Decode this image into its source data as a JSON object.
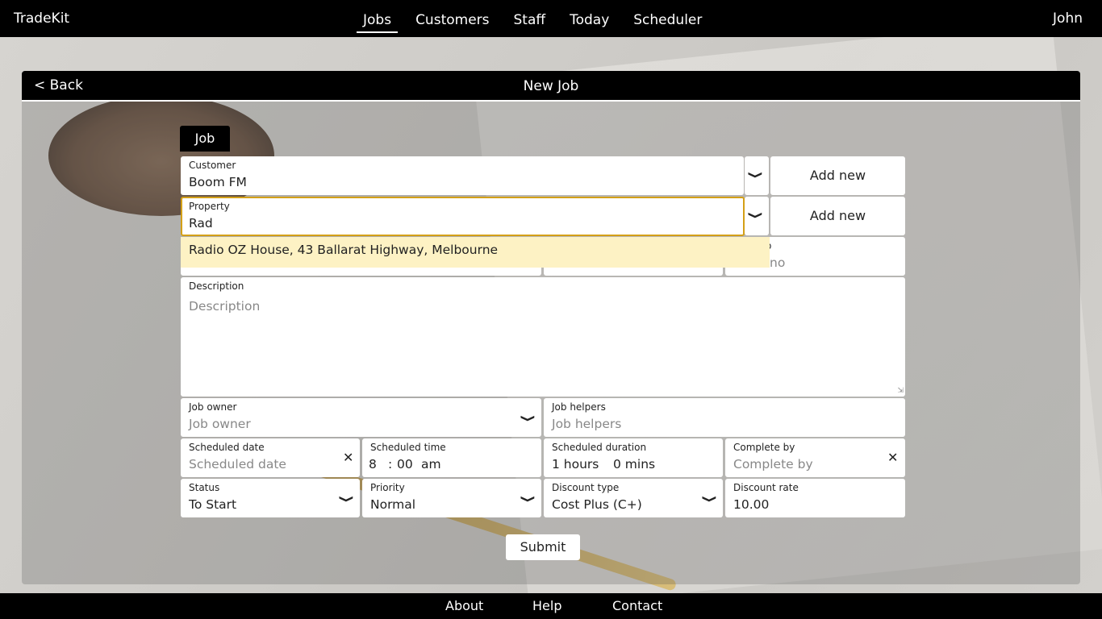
{
  "app": {
    "brand": "TradeKit",
    "user": "John"
  },
  "nav": {
    "items": [
      "Jobs",
      "Customers",
      "Staff",
      "Today",
      "Scheduler"
    ],
    "active": "Jobs"
  },
  "panel": {
    "back": "< Back",
    "title": "New Job",
    "tab": "Job"
  },
  "form": {
    "customer": {
      "label": "Customer",
      "value": "Boom FM",
      "add": "Add new"
    },
    "property": {
      "label": "Property",
      "value": "Rad",
      "add": "Add new"
    },
    "suggestion": "Radio OZ House, 43 Ballarat Highway, Melbourne",
    "hidden_row": {
      "label_fragment": "o",
      "value_fragment": "no"
    },
    "description": {
      "label": "Description",
      "placeholder": "Description"
    },
    "job_owner": {
      "label": "Job owner",
      "placeholder": "Job owner"
    },
    "job_helpers": {
      "label": "Job helpers",
      "placeholder": "Job helpers"
    },
    "scheduled_date": {
      "label": "Scheduled date",
      "placeholder": "Scheduled date"
    },
    "scheduled_time": {
      "label": "Scheduled time",
      "hour": "8",
      "sep": ":",
      "minute": "00",
      "ampm": "am"
    },
    "scheduled_duration": {
      "label": "Scheduled duration",
      "hours": "1 hours",
      "mins": "0 mins"
    },
    "complete_by": {
      "label": "Complete by",
      "placeholder": "Complete by"
    },
    "status": {
      "label": "Status",
      "value": "To Start"
    },
    "priority": {
      "label": "Priority",
      "value": "Normal"
    },
    "discount_type": {
      "label": "Discount type",
      "value": "Cost Plus (C+)"
    },
    "discount_rate": {
      "label": "Discount rate",
      "value": "10.00"
    },
    "submit": "Submit"
  },
  "footer": {
    "links": [
      "About",
      "Help",
      "Contact"
    ]
  },
  "colors": {
    "bar": "#000000",
    "focus": "#d4a017",
    "suggestion_bg": "#fdf2c4"
  }
}
